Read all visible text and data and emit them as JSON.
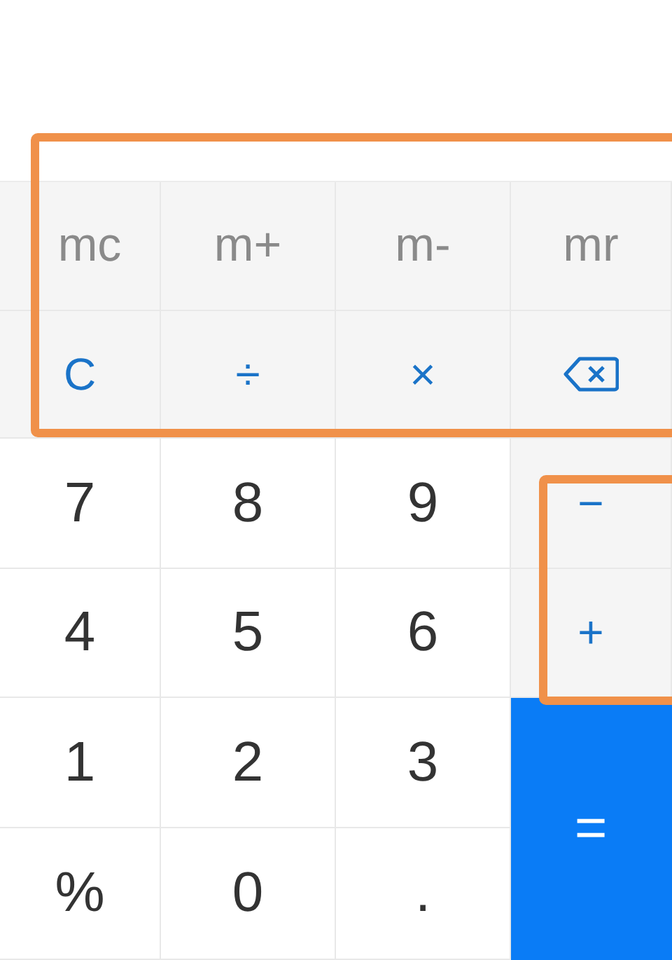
{
  "memory_keys": [
    {
      "label": "mc"
    },
    {
      "label": "m+"
    },
    {
      "label": "m-"
    },
    {
      "label": "mr"
    }
  ],
  "function_keys": [
    {
      "kind": "clear",
      "label": "C"
    },
    {
      "kind": "operator",
      "label": "÷"
    },
    {
      "kind": "operator",
      "label": "×"
    },
    {
      "kind": "backspace"
    }
  ],
  "keypad": [
    {
      "kind": "digit",
      "label": "7"
    },
    {
      "kind": "digit",
      "label": "8"
    },
    {
      "kind": "digit",
      "label": "9"
    },
    {
      "kind": "operator",
      "label": "−"
    },
    {
      "kind": "digit",
      "label": "4"
    },
    {
      "kind": "digit",
      "label": "5"
    },
    {
      "kind": "digit",
      "label": "6"
    },
    {
      "kind": "operator",
      "label": "+"
    },
    {
      "kind": "digit",
      "label": "1"
    },
    {
      "kind": "digit",
      "label": "2"
    },
    {
      "kind": "digit",
      "label": "3"
    },
    {
      "kind": "equals",
      "label": "="
    },
    {
      "kind": "digit",
      "label": "%"
    },
    {
      "kind": "digit",
      "label": "0"
    },
    {
      "kind": "digit",
      "label": "."
    }
  ]
}
